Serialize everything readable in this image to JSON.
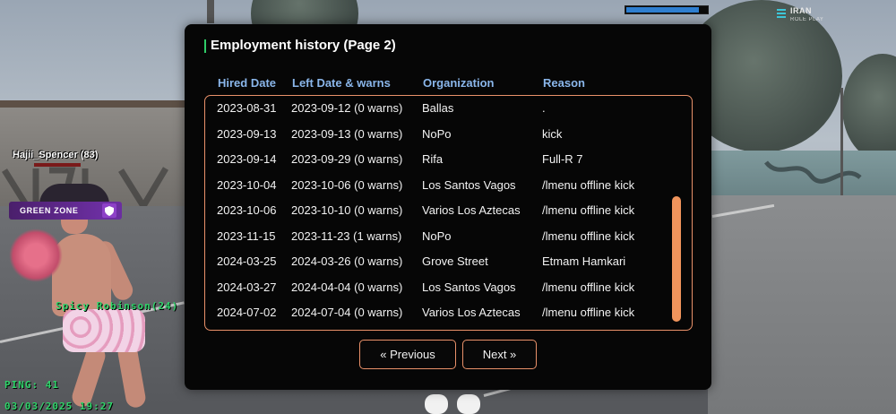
{
  "hud": {
    "player_tag": "Hajii_Spencer (83)",
    "zone_label": "GREEN ZONE",
    "other_player": "Spicy Robinson(24)",
    "ping": "PING: 41",
    "datetime": "03/03/2025 19:27",
    "top_bar_progress": 0.9,
    "logo_main": "IRAN",
    "logo_sub": "ROLE PLAY",
    "zone_color": "#6b2ea0",
    "hud_text_color": "#2fd46a"
  },
  "dialog": {
    "title": "Employment history (Page 2)",
    "accent_color": "#e9916a",
    "header_color": "#8ab6ea",
    "columns": [
      "Hired Date",
      "Left Date & warns",
      "Organization",
      "Reason"
    ],
    "rows": [
      [
        "2023-08-31",
        "2023-09-12 (0 warns)",
        "Ballas",
        "."
      ],
      [
        "2023-09-13",
        "2023-09-13 (0 warns)",
        "NoPo",
        "kick"
      ],
      [
        "2023-09-14",
        "2023-09-29 (0 warns)",
        "Rifa",
        "Full-R 7"
      ],
      [
        "2023-10-04",
        "2023-10-06 (0 warns)",
        "Los Santos Vagos",
        "/lmenu offline kick"
      ],
      [
        "2023-10-06",
        "2023-10-10 (0 warns)",
        "Varios Los Aztecas",
        "/lmenu offline kick"
      ],
      [
        "2023-11-15",
        "2023-11-23 (1 warns)",
        "NoPo",
        "/lmenu offline kick"
      ],
      [
        "2024-03-25",
        "2024-03-26 (0 warns)",
        "Grove Street",
        "Etmam Hamkari"
      ],
      [
        "2024-03-27",
        "2024-04-04 (0 warns)",
        "Los Santos Vagos",
        "/lmenu offline kick"
      ],
      [
        "2024-07-02",
        "2024-07-04 (0 warns)",
        "Varios Los Aztecas",
        "/lmenu offline kick"
      ]
    ],
    "prev_label": "« Previous",
    "next_label": "Next »"
  }
}
